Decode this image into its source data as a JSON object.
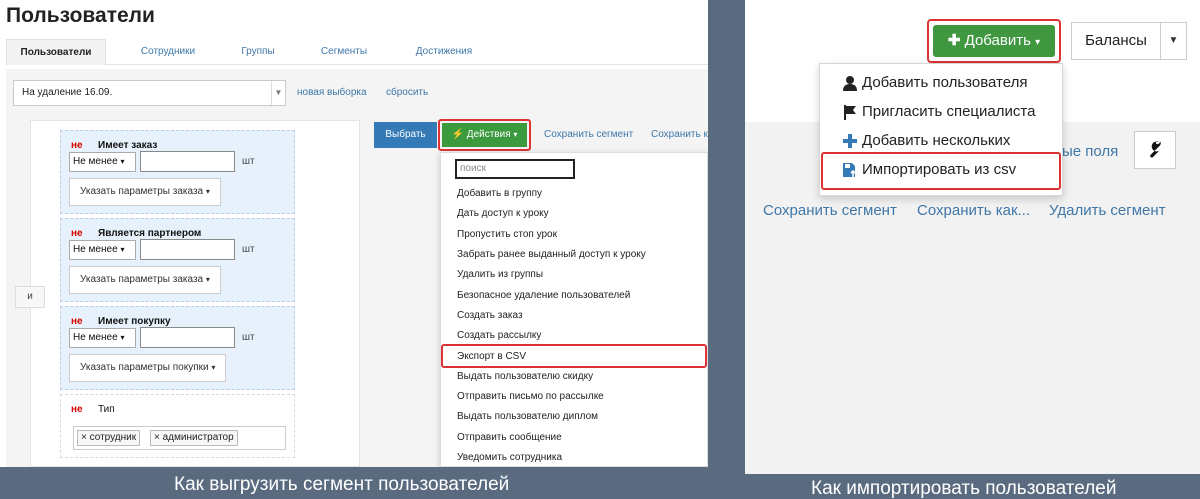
{
  "left": {
    "page_title": "Пользователи",
    "tabs": [
      "Пользователи",
      "Сотрудники",
      "Группы",
      "Сегменты",
      "Достижения"
    ],
    "segment_select": "На удаление 16.09.",
    "new_selection": "новая выборка",
    "reset": "сбросить",
    "and_label": "и",
    "conditions": [
      {
        "not": "не",
        "title": "Имеет заказ",
        "compare": "Не менее",
        "unit": "шт",
        "params": "Указать параметры заказа"
      },
      {
        "not": "не",
        "title": "Является партнером",
        "compare": "Не менее",
        "unit": "шт",
        "params": "Указать параметры заказа"
      },
      {
        "not": "не",
        "title": "Имеет покупку",
        "compare": "Не менее",
        "unit": "шт",
        "params": "Указать параметры покупки"
      }
    ],
    "type_condition": {
      "not": "не",
      "title": "Тип",
      "tags": [
        "сотрудник",
        "администратор"
      ]
    },
    "select_button": "Выбрать",
    "actions_button": "Действия",
    "save_segment": "Сохранить сегмент",
    "save_as": "Сохранить к",
    "search_placeholder": "поиск",
    "actions_menu": [
      "Добавить в группу",
      "Дать доступ к уроку",
      "Пропустить стоп урок",
      "Забрать ранее выданный доступ к уроку",
      "Удалить из группы",
      "Безопасное удаление пользователей",
      "Создать заказ",
      "Создать рассылку",
      "Экспорт в CSV",
      "Выдать пользователю скидку",
      "Отправить письмо по рассылке",
      "Выдать пользователю диплом",
      "Отправить сообщение",
      "Уведомить сотрудника"
    ]
  },
  "right": {
    "add_button": "Добавить",
    "balances_button": "Балансы",
    "add_menu": [
      {
        "label": "Добавить пользователя",
        "icon": "user-icon"
      },
      {
        "label": "Пригласить специалиста",
        "icon": "flag-icon"
      },
      {
        "label": "Добавить нескольких",
        "icon": "plus-icon"
      },
      {
        "label": "Импортировать из csv",
        "icon": "import-icon"
      }
    ],
    "fields_link": "ые поля",
    "seg_links": [
      "Сохранить сегмент",
      "Сохранить как...",
      "Удалить сегмент"
    ]
  },
  "captions": {
    "left": "Как выгрузить сегмент пользователей",
    "right": "Как импортировать пользователей"
  },
  "colors": {
    "highlight": "#dd3333",
    "green": "#3f973f",
    "blue": "#337ab7",
    "link": "#3f77a8"
  }
}
